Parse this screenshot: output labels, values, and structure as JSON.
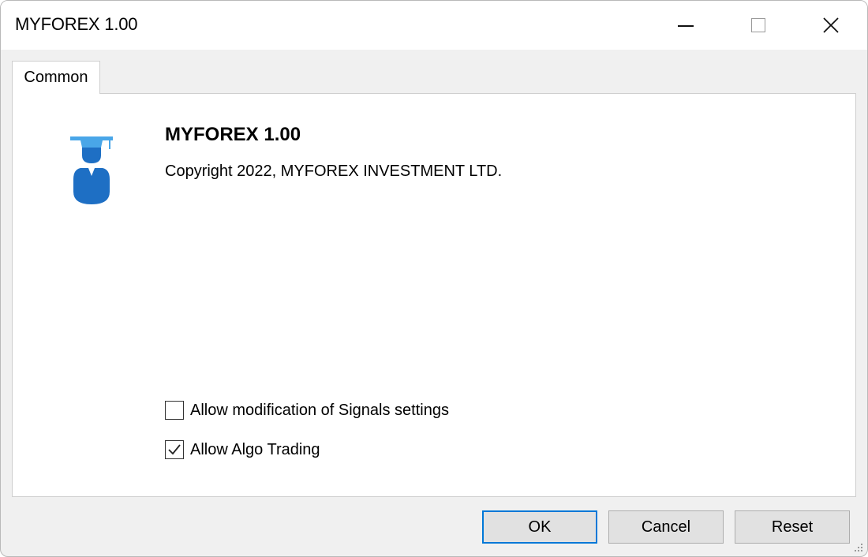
{
  "window": {
    "title": "MYFOREX 1.00",
    "controls": {
      "minimize": "minimize-icon",
      "maximize": "maximize-icon",
      "close": "close-icon"
    }
  },
  "tabs": [
    {
      "label": "Common",
      "active": true
    }
  ],
  "info": {
    "icon": "graduate-icon",
    "name": "MYFOREX 1.00",
    "copyright": "Copyright 2022, MYFOREX INVESTMENT LTD."
  },
  "options": [
    {
      "label": "Allow modification of Signals settings",
      "checked": false
    },
    {
      "label": "Allow Algo Trading",
      "checked": true
    }
  ],
  "buttons": {
    "ok": "OK",
    "cancel": "Cancel",
    "reset": "Reset"
  },
  "colors": {
    "accent": "#0078d7",
    "icon_blue": "#1e6fc4",
    "icon_light": "#49a6e8"
  }
}
